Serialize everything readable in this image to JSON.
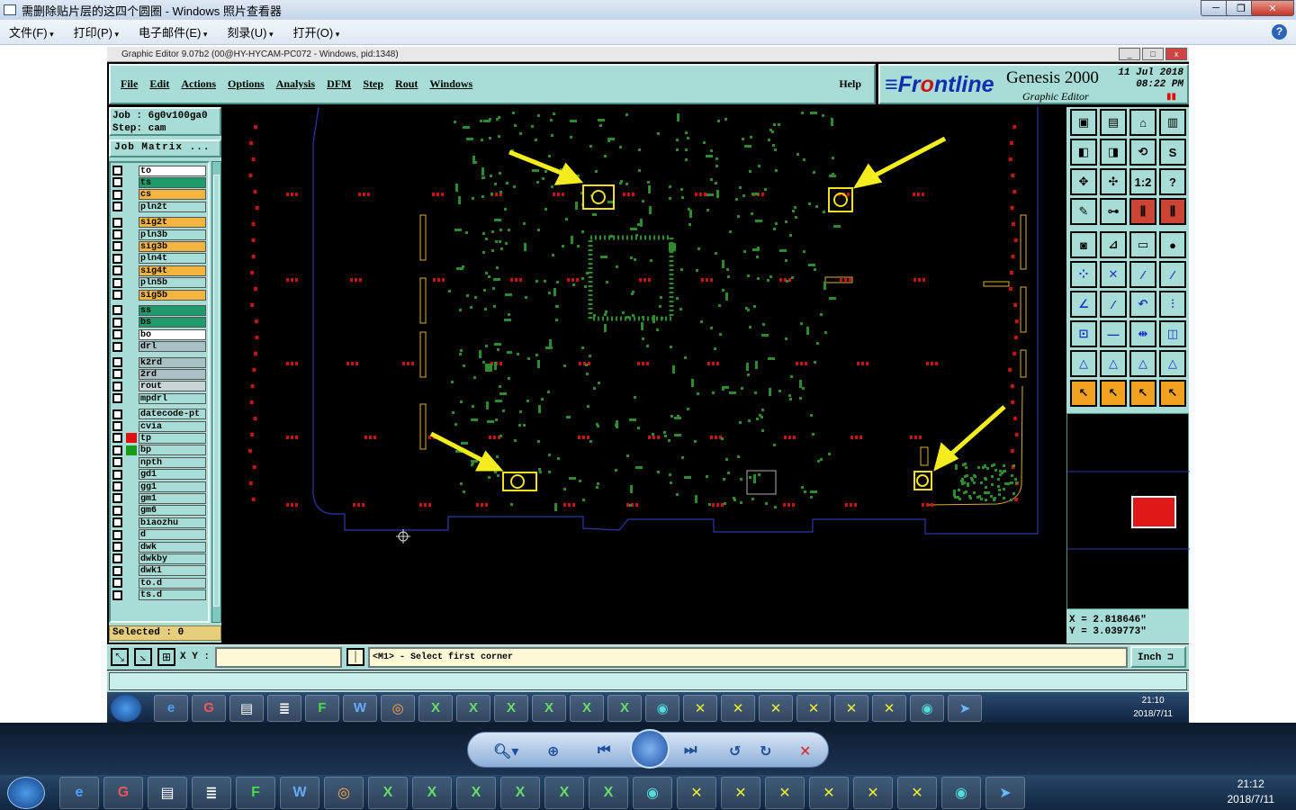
{
  "viewer": {
    "title": "需删除贴片层的这四个圆圈 - Windows 照片查看器",
    "menu": [
      "文件(F)",
      "打印(P)",
      "电子邮件(E)",
      "刻录(U)",
      "打开(O)"
    ],
    "help": "?"
  },
  "ge": {
    "title": "Graphic Editor 9.07b2 (00@HY-HYCAM-PC072 - Windows, pid:1348)",
    "menu": [
      "File",
      "Edit",
      "Actions",
      "Options",
      "Analysis",
      "DFM",
      "Step",
      "Rout",
      "Windows"
    ],
    "help": "Help",
    "logo_prefix": "≡Fr",
    "logo_o": "o",
    "logo_rest": "ntline",
    "product": "Genesis 2000",
    "subtitle": "Graphic Editor",
    "date": "11 Jul 2018",
    "time": "08:22 PM",
    "job": "Job : 6g0v100ga0",
    "step": "Step: cam",
    "job_matrix": "Job Matrix ...",
    "selected": "Selected : 0",
    "coord_x": "X = 2.818646\"",
    "coord_y": "Y = 3.039773\"",
    "xy_label": "X Y :",
    "status": "<M1> - Select first corner",
    "unit": "Inch ⊐",
    "colors": {
      "panel": "#a7ddd6",
      "yellow": "#f0c040",
      "green": "#1f9a6b",
      "white": "#ffffff",
      "grey": "#a9c0c5"
    },
    "layers": [
      {
        "name": "to",
        "color": "#ffffff"
      },
      {
        "name": "ts",
        "color": "#1f9a6b"
      },
      {
        "name": "cs",
        "color": "#f3b540"
      },
      {
        "name": "pln2t",
        "color": "#a7ddd6"
      },
      {
        "name": "sig2t",
        "color": "#f3b540"
      },
      {
        "name": "pln3b",
        "color": "#a7ddd6"
      },
      {
        "name": "sig3b",
        "color": "#f3b540"
      },
      {
        "name": "pln4t",
        "color": "#a7ddd6"
      },
      {
        "name": "sig4t",
        "color": "#f3b540"
      },
      {
        "name": "pln5b",
        "color": "#a7ddd6"
      },
      {
        "name": "sig5b",
        "color": "#f3b540"
      },
      {
        "name": "ss",
        "color": "#1f9a6b"
      },
      {
        "name": "bs",
        "color": "#1f9a6b"
      },
      {
        "name": "bo",
        "color": "#ffffff"
      },
      {
        "name": "drl",
        "color": "#a9c0c5"
      },
      {
        "name": "k2rd",
        "color": "#a9c0c5"
      },
      {
        "name": "2rd",
        "color": "#a9c0c5"
      },
      {
        "name": "rout",
        "color": "#c8d4d6"
      },
      {
        "name": "mpdrl",
        "color": "#a7ddd6"
      },
      {
        "name": "datecode-pt",
        "color": "#a7ddd6"
      },
      {
        "name": "cvia",
        "color": "#a7ddd6"
      },
      {
        "name": "tp",
        "color": "#a7ddd6"
      },
      {
        "name": "bp",
        "color": "#a7ddd6"
      },
      {
        "name": "npth",
        "color": "#a7ddd6"
      },
      {
        "name": "gd1",
        "color": "#a7ddd6"
      },
      {
        "name": "gg1",
        "color": "#a7ddd6"
      },
      {
        "name": "gm1",
        "color": "#a7ddd6"
      },
      {
        "name": "gm6",
        "color": "#a7ddd6"
      },
      {
        "name": "biaozhu",
        "color": "#a7ddd6"
      },
      {
        "name": "d",
        "color": "#a7ddd6"
      },
      {
        "name": "dwk",
        "color": "#a7ddd6"
      },
      {
        "name": "dwkby",
        "color": "#a7ddd6"
      },
      {
        "name": "dwk1",
        "color": "#a7ddd6"
      },
      {
        "name": "to.d",
        "color": "#a7ddd6"
      },
      {
        "name": "ts.d",
        "color": "#a7ddd6"
      }
    ],
    "inner_clock_time": "21:10",
    "inner_clock_date": "2018/7/11"
  },
  "taskbar": {
    "time": "21:12",
    "date": "2018/7/11"
  }
}
